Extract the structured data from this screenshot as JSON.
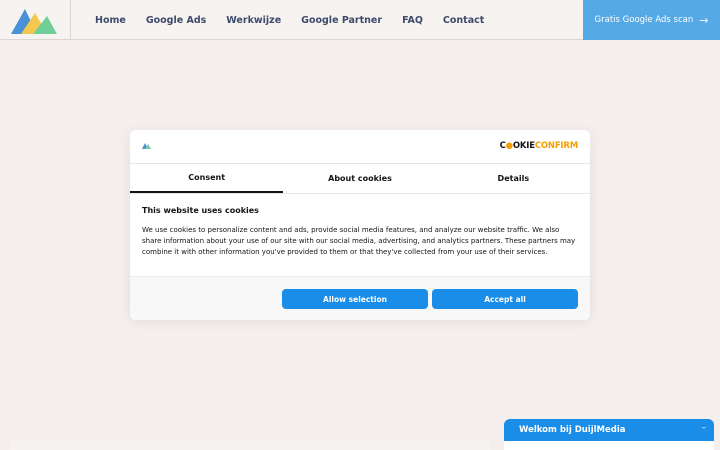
{
  "header": {
    "logo_name": "mountains-logo",
    "nav": [
      "Home",
      "Google Ads",
      "Werkwijze",
      "Google Partner",
      "FAQ",
      "Contact"
    ],
    "cta_label": "Gratis Google Ads scan",
    "cta_icon": "arrow-right-icon"
  },
  "cookie_dialog": {
    "brand": "COOKIECONFIRM",
    "tabs": [
      "Consent",
      "About cookies",
      "Details"
    ],
    "active_tab": "Consent",
    "title": "This website uses cookies",
    "text": "We use cookies to personalize content and ads, provide social media features, and analyze our website traffic. We also share information about your use of our site with our social media, advertising, and analytics partners. These partners may combine it with other information you've provided to them or that they've collected from your use of their services.",
    "allow_selection": "Allow selection",
    "accept_all": "Accept all"
  },
  "chat": {
    "title": "Welkom bij DuijlMedia",
    "minimize": "–"
  },
  "colors": {
    "accent": "#1a8de8",
    "cta": "#55a9e5",
    "nav_text": "#3d4a6b",
    "background": "#f4efed"
  }
}
